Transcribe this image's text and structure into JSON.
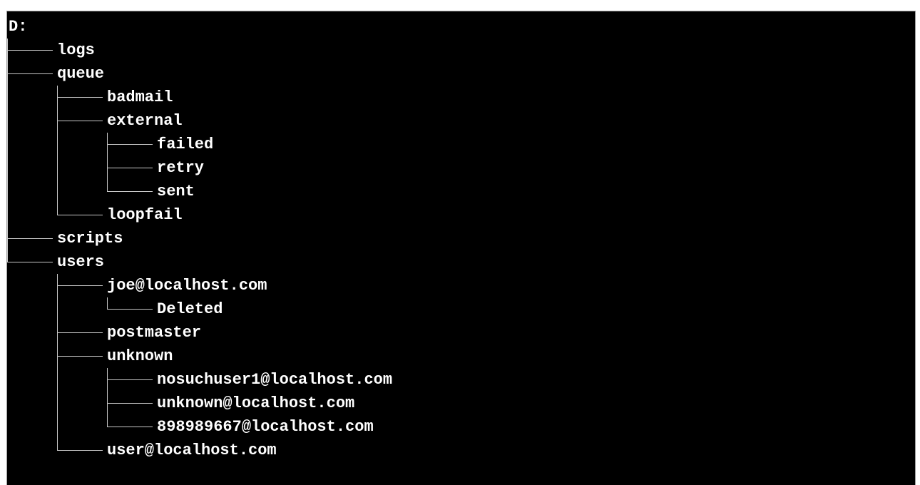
{
  "tree": [
    {
      "label": "D:",
      "depth": 0,
      "last": false,
      "root": true,
      "guides": []
    },
    {
      "label": "logs",
      "depth": 1,
      "last": false,
      "guides": []
    },
    {
      "label": "queue",
      "depth": 1,
      "last": false,
      "guides": []
    },
    {
      "label": "badmail",
      "depth": 2,
      "last": false,
      "guides": [
        true
      ]
    },
    {
      "label": "external",
      "depth": 2,
      "last": false,
      "guides": [
        true
      ]
    },
    {
      "label": "failed",
      "depth": 3,
      "last": false,
      "guides": [
        true,
        true
      ]
    },
    {
      "label": "retry",
      "depth": 3,
      "last": false,
      "guides": [
        true,
        true
      ]
    },
    {
      "label": "sent",
      "depth": 3,
      "last": true,
      "guides": [
        true,
        true
      ]
    },
    {
      "label": "loopfail",
      "depth": 2,
      "last": true,
      "guides": [
        true
      ]
    },
    {
      "label": "scripts",
      "depth": 1,
      "last": false,
      "guides": []
    },
    {
      "label": "users",
      "depth": 1,
      "last": true,
      "guides": []
    },
    {
      "label": "joe@localhost.com",
      "depth": 2,
      "last": false,
      "guides": [
        false
      ]
    },
    {
      "label": "Deleted",
      "depth": 3,
      "last": true,
      "guides": [
        false,
        true
      ]
    },
    {
      "label": "postmaster",
      "depth": 2,
      "last": false,
      "guides": [
        false
      ]
    },
    {
      "label": "unknown",
      "depth": 2,
      "last": false,
      "guides": [
        false
      ]
    },
    {
      "label": "nosuchuser1@localhost.com",
      "depth": 3,
      "last": false,
      "guides": [
        false,
        true
      ]
    },
    {
      "label": "unknown@localhost.com",
      "depth": 3,
      "last": false,
      "guides": [
        false,
        true
      ]
    },
    {
      "label": "898989667@localhost.com",
      "depth": 3,
      "last": true,
      "guides": [
        false,
        true
      ]
    },
    {
      "label": "user@localhost.com",
      "depth": 2,
      "last": true,
      "guides": [
        false
      ]
    }
  ],
  "colors": {
    "background": "#000000",
    "text": "#ffffff",
    "connector": "#c8c8c8"
  }
}
